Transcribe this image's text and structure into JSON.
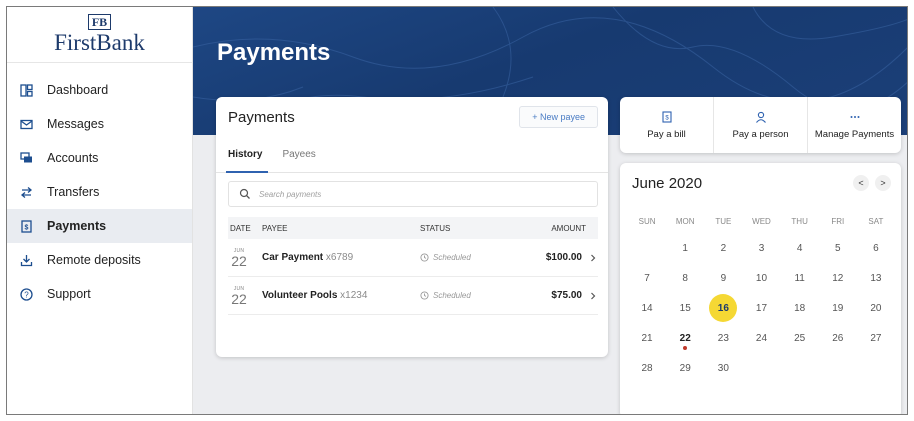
{
  "brand": {
    "mark": "FB",
    "name": "FirstBank"
  },
  "sidebar": {
    "items": [
      {
        "label": "Dashboard",
        "icon": "dashboard-icon"
      },
      {
        "label": "Messages",
        "icon": "envelope-icon"
      },
      {
        "label": "Accounts",
        "icon": "accounts-icon"
      },
      {
        "label": "Transfers",
        "icon": "transfer-arrows-icon"
      },
      {
        "label": "Payments",
        "icon": "payments-icon",
        "active": true
      },
      {
        "label": "Remote deposits",
        "icon": "download-icon"
      },
      {
        "label": "Support",
        "icon": "help-icon"
      }
    ]
  },
  "header": {
    "title": "Payments"
  },
  "payments_card": {
    "title": "Payments",
    "new_payee_label": "+ New payee",
    "tabs": [
      {
        "label": "History",
        "active": true
      },
      {
        "label": "Payees"
      }
    ],
    "search_placeholder": "Search payments",
    "columns": {
      "date": "DATE",
      "payee": "PAYEE",
      "status": "STATUS",
      "amount": "AMOUNT"
    },
    "rows": [
      {
        "month": "JUN",
        "day": "22",
        "payee": "Car Payment",
        "account": "x6789",
        "status": "Scheduled",
        "amount": "$100.00"
      },
      {
        "month": "JUN",
        "day": "22",
        "payee": "Volunteer Pools",
        "account": "x1234",
        "status": "Scheduled",
        "amount": "$75.00"
      }
    ]
  },
  "actions": [
    {
      "label": "Pay a bill",
      "icon": "bill-icon"
    },
    {
      "label": "Pay a person",
      "icon": "person-icon"
    },
    {
      "label": "Manage Payments",
      "icon": "more-dots-icon"
    }
  ],
  "calendar": {
    "month_label": "June 2020",
    "prev": "<",
    "next": ">",
    "weekdays": [
      "SUN",
      "MON",
      "TUE",
      "WED",
      "THU",
      "FRI",
      "SAT"
    ],
    "days": [
      "1",
      "2",
      "3",
      "4",
      "5",
      "6",
      "7",
      "8",
      "9",
      "10",
      "11",
      "12",
      "13",
      "14",
      "15",
      "16",
      "17",
      "18",
      "19",
      "20",
      "21",
      "22",
      "23",
      "24",
      "25",
      "26",
      "27",
      "28",
      "29",
      "30"
    ],
    "today": "16",
    "marked": "22"
  },
  "colors": {
    "brand_navy": "#1d3a6b",
    "accent_blue": "#2f62b0",
    "today_yellow": "#f5d834",
    "marker_red": "#c0392b"
  }
}
